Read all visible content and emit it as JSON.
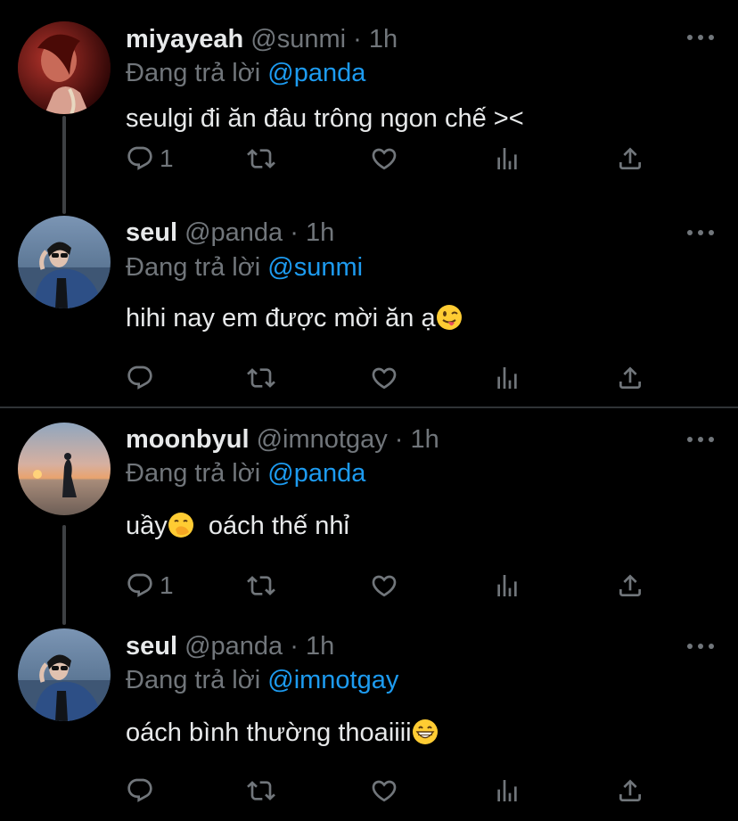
{
  "replying_prefix": "Đang trả lời",
  "colors": {
    "background": "#000000",
    "primary_text": "#e7e9ea",
    "secondary_text": "#71767b",
    "accent": "#1d9bf0",
    "divider": "#2f3336"
  },
  "tweets": [
    {
      "display_name": "miyayeah",
      "handle": "@sunmi",
      "time": "1h",
      "replying_to": "@panda",
      "text": "seulgi đi ăn đâu trông ngon chế ><",
      "emoji": "",
      "reply_count": "1",
      "avatar_icon": "red-portrait-avatar"
    },
    {
      "display_name": "seul",
      "handle": "@panda",
      "time": "1h",
      "replying_to": "@sunmi",
      "text": "hihi nay em được mời ăn ạ",
      "emoji": "winking-face-with-tongue",
      "reply_count": "",
      "avatar_icon": "denim-jacket-portrait-avatar"
    },
    {
      "display_name": "moonbyul",
      "handle": "@imnotgay",
      "time": "1h",
      "replying_to": "@panda",
      "text_before": "uầy",
      "emoji": "face-with-hand-over-mouth",
      "text_after": "  oách thế nhỉ",
      "reply_count": "1",
      "avatar_icon": "sunset-silhouette-avatar"
    },
    {
      "display_name": "seul",
      "handle": "@panda",
      "time": "1h",
      "replying_to": "@imnotgay",
      "text": "oách bình thường thoaiiii",
      "emoji": "grinning-face-with-smiling-eyes",
      "reply_count": "",
      "avatar_icon": "denim-jacket-portrait-avatar"
    }
  ]
}
